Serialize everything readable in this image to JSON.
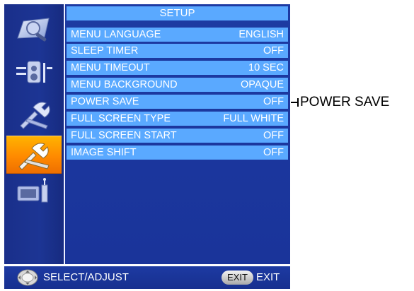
{
  "menu": {
    "title": "SETUP",
    "items": [
      {
        "label": "MENU LANGUAGE",
        "value": "ENGLISH"
      },
      {
        "label": "SLEEP TIMER",
        "value": "OFF"
      },
      {
        "label": "MENU TIMEOUT",
        "value": "10 SEC"
      },
      {
        "label": "MENU BACKGROUND",
        "value": "OPAQUE"
      },
      {
        "label": "POWER SAVE",
        "value": "OFF"
      },
      {
        "label": "FULL SCREEN TYPE",
        "value": "FULL WHITE"
      },
      {
        "label": "FULL SCREEN START",
        "value": "OFF"
      },
      {
        "label": "IMAGE SHIFT",
        "value": "OFF"
      }
    ]
  },
  "sidebar": {
    "items": [
      {
        "icon": "picture-adjust-icon",
        "active": false
      },
      {
        "icon": "audio-settings-icon",
        "active": false
      },
      {
        "icon": "tools-icon",
        "active": false
      },
      {
        "icon": "setup-tools-icon",
        "active": true
      },
      {
        "icon": "monitor-input-icon",
        "active": false
      }
    ],
    "active_color": "#ff9a00"
  },
  "footer": {
    "select_icon": "joystick-icon",
    "select_label": "SELECT/ADJUST",
    "exit_key": "EXIT",
    "exit_label": "EXIT"
  },
  "callout": {
    "label": "POWER SAVE"
  },
  "colors": {
    "panel_bg": "#1c379c",
    "row_bg": "#5aa9ff",
    "text": "#ffffff"
  }
}
